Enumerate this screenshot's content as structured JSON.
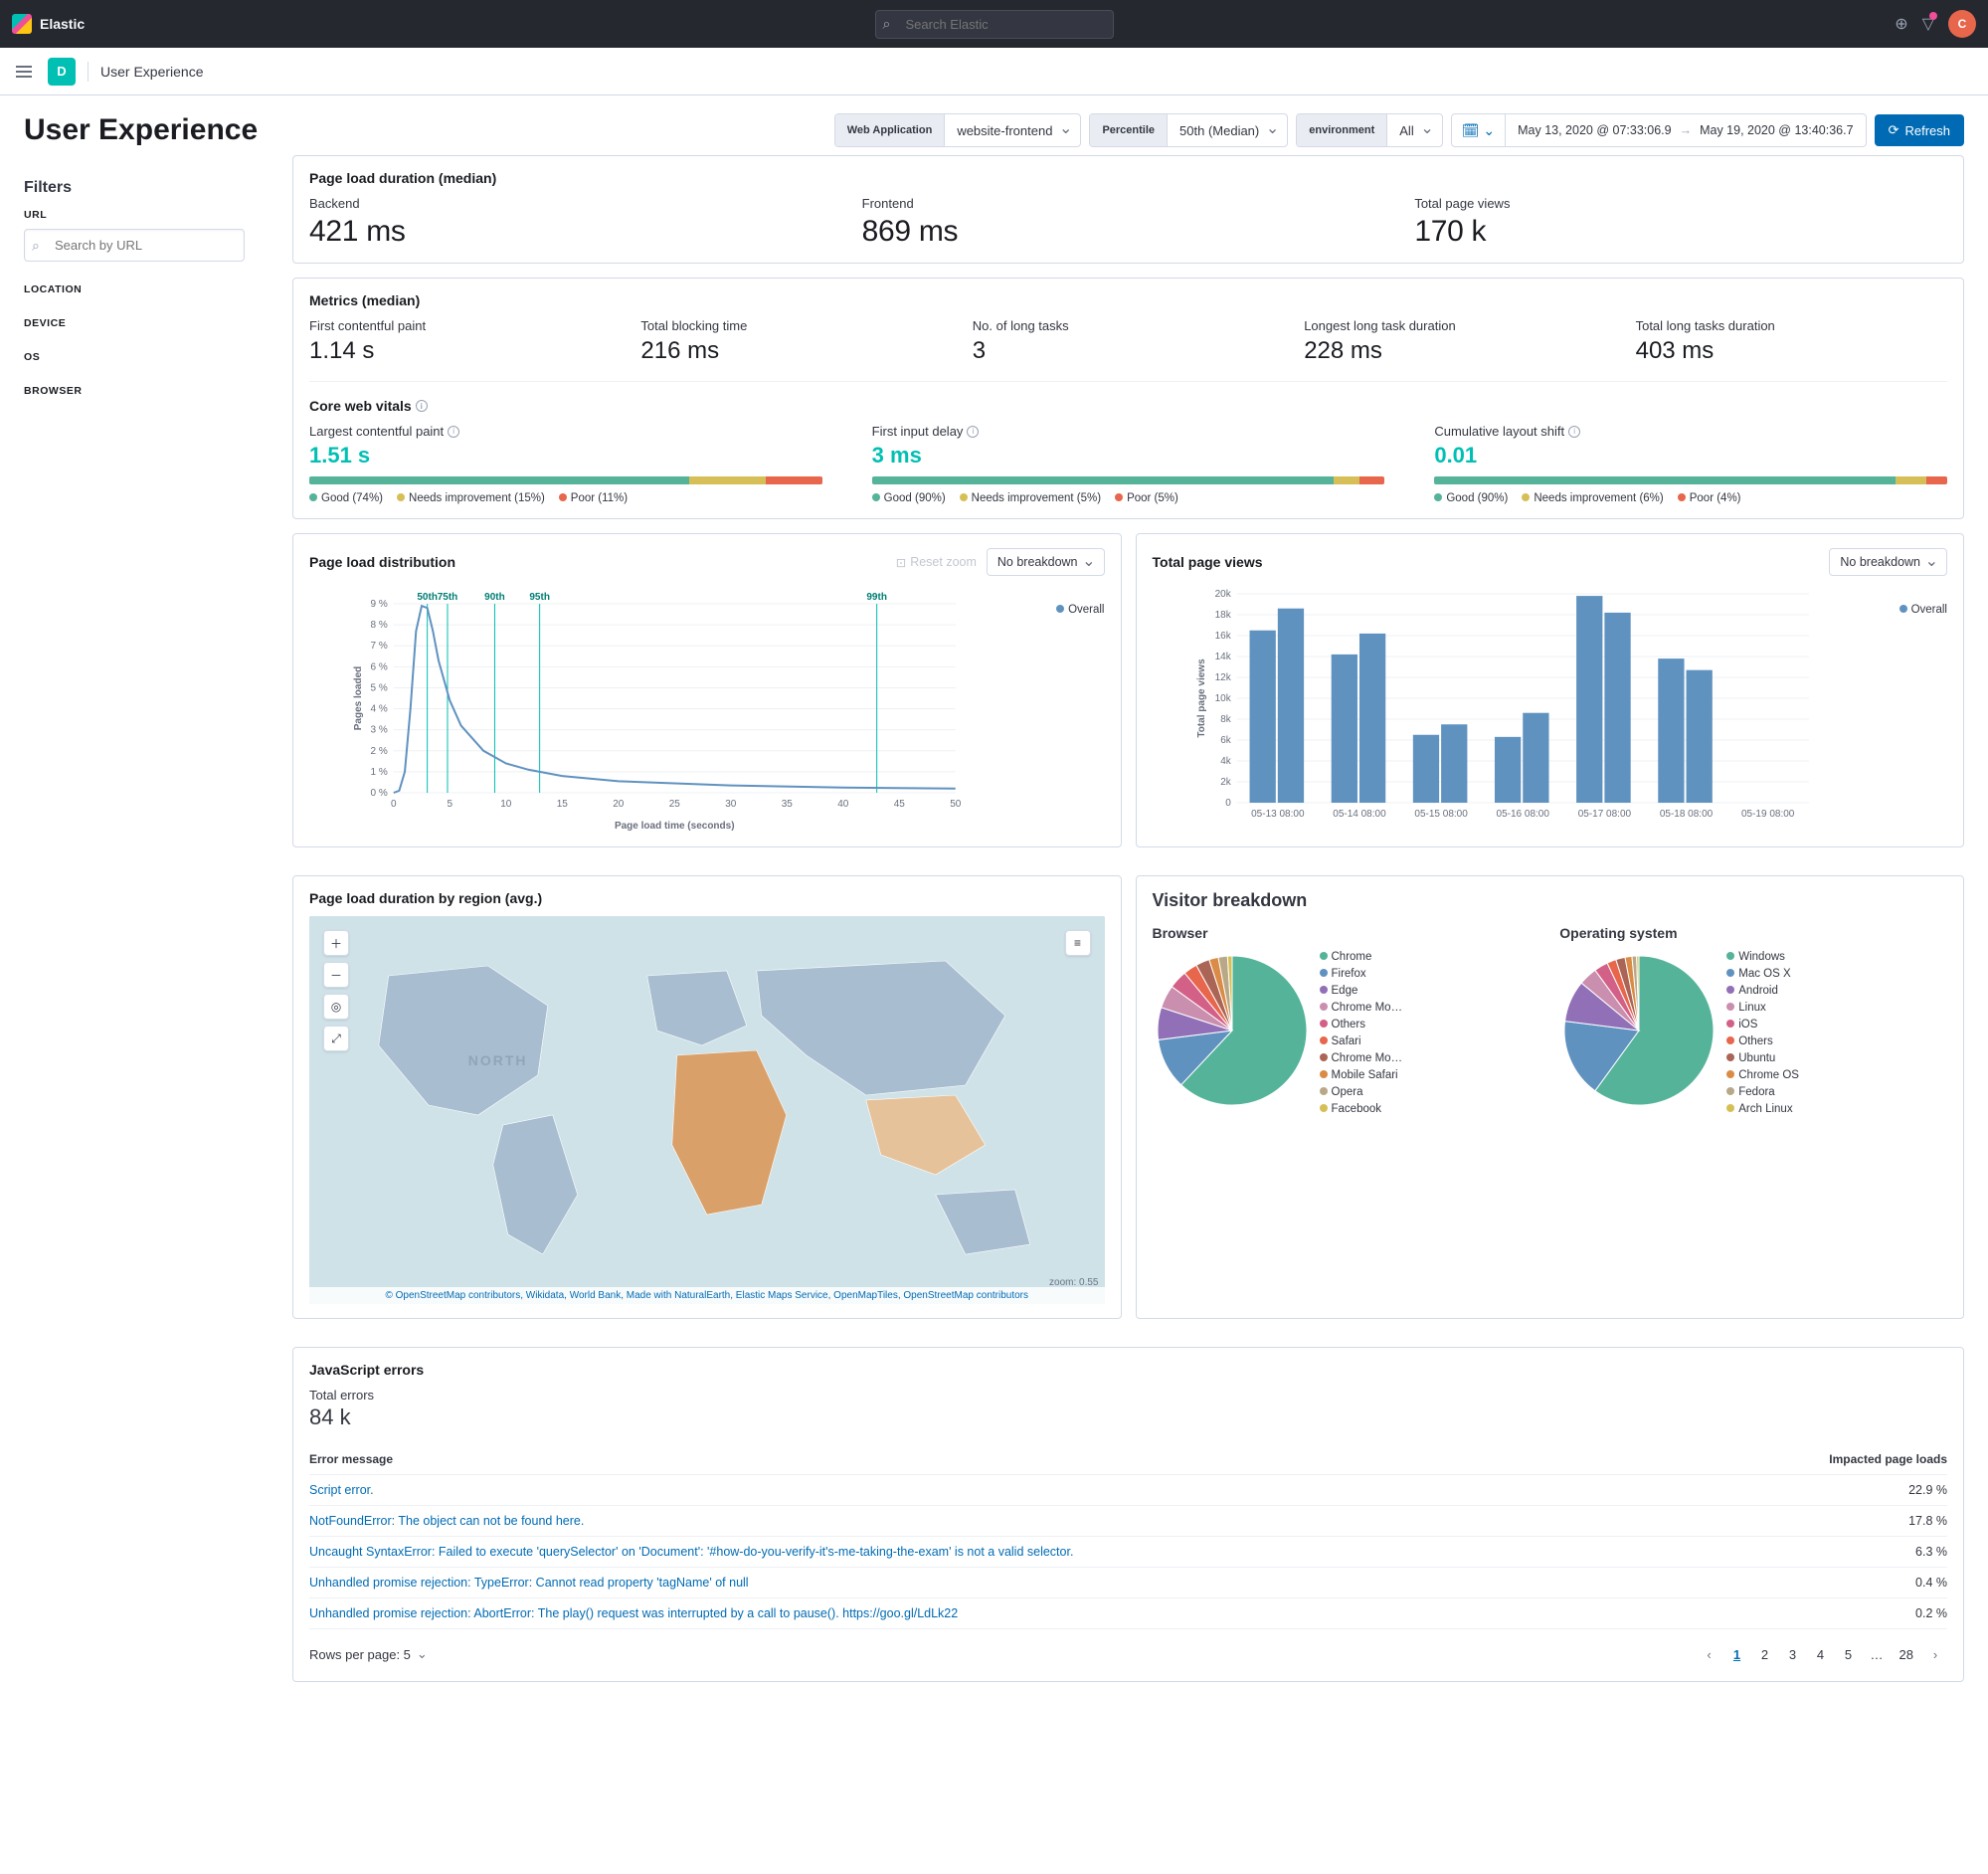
{
  "topbar": {
    "brand": "Elastic",
    "search_placeholder": "Search Elastic",
    "avatar_initial": "C"
  },
  "subbar": {
    "app_initial": "D",
    "breadcrumb": "User Experience"
  },
  "page": {
    "title": "User Experience",
    "web_app_label": "Web Application",
    "web_app_value": "website-frontend",
    "percentile_label": "Percentile",
    "percentile_value": "50th (Median)",
    "environment_label": "environment",
    "environment_value": "All",
    "date_from": "May 13, 2020 @ 07:33:06.9",
    "date_to": "May 19, 2020 @ 13:40:36.7",
    "refresh": "Refresh"
  },
  "filters": {
    "title": "Filters",
    "url_label": "URL",
    "url_placeholder": "Search by URL",
    "location_label": "LOCATION",
    "device_label": "DEVICE",
    "os_label": "OS",
    "browser_label": "BROWSER"
  },
  "page_load": {
    "title": "Page load duration (median)",
    "backend_label": "Backend",
    "backend_value": "421 ms",
    "frontend_label": "Frontend",
    "frontend_value": "869 ms",
    "views_label": "Total page views",
    "views_value": "170 k"
  },
  "metrics": {
    "title": "Metrics (median)",
    "fcp_label": "First contentful paint",
    "fcp_value": "1.14 s",
    "tbt_label": "Total blocking time",
    "tbt_value": "216 ms",
    "long_count_label": "No. of long tasks",
    "long_count_value": "3",
    "longest_label": "Longest long task duration",
    "longest_value": "228 ms",
    "total_long_label": "Total long tasks duration",
    "total_long_value": "403 ms"
  },
  "vitals": {
    "title": "Core web vitals",
    "lcp": {
      "label": "Largest contentful paint",
      "value": "1.51 s",
      "good": 74,
      "imp": 15,
      "poor": 11,
      "good_text": "Good (74%)",
      "imp_text": "Needs improvement (15%)",
      "poor_text": "Poor (11%)"
    },
    "fid": {
      "label": "First input delay",
      "value": "3 ms",
      "good": 90,
      "imp": 5,
      "poor": 5,
      "good_text": "Good (90%)",
      "imp_text": "Needs improvement (5%)",
      "poor_text": "Poor (5%)"
    },
    "cls": {
      "label": "Cumulative layout shift",
      "value": "0.01",
      "good": 90,
      "imp": 6,
      "poor": 4,
      "good_text": "Good (90%)",
      "imp_text": "Needs improvement (6%)",
      "poor_text": "Poor (4%)"
    }
  },
  "dist": {
    "title": "Page load distribution",
    "reset": "Reset zoom",
    "breakdown": "No breakdown",
    "legend": "Overall",
    "xlabel": "Page load time (seconds)",
    "ylabel": "Pages loaded",
    "p50": "50th",
    "p75": "75th",
    "p90": "90th",
    "p95": "95th",
    "p99": "99th"
  },
  "views": {
    "title": "Total page views",
    "breakdown": "No breakdown",
    "legend": "Overall",
    "ylabel": "Total page views"
  },
  "region": {
    "title": "Page load duration by region (avg.)",
    "attrib": "© OpenStreetMap contributors, Wikidata, World Bank, Made with NaturalEarth, Elastic Maps Service, OpenMapTiles, OpenStreetMap contributors",
    "zoom": "zoom: 0.55"
  },
  "visitor": {
    "title": "Visitor breakdown",
    "browser_title": "Browser",
    "os_title": "Operating system",
    "browsers": [
      "Chrome",
      "Firefox",
      "Edge",
      "Chrome Mo…",
      "Others",
      "Safari",
      "Chrome Mo…",
      "Mobile Safari",
      "Opera",
      "Facebook"
    ],
    "os": [
      "Windows",
      "Mac OS X",
      "Android",
      "Linux",
      "iOS",
      "Others",
      "Ubuntu",
      "Chrome OS",
      "Fedora",
      "Arch Linux"
    ]
  },
  "errors": {
    "title": "JavaScript errors",
    "total_label": "Total errors",
    "total_value": "84 k",
    "col_msg": "Error message",
    "col_pct": "Impacted page loads",
    "rows": [
      {
        "msg": "Script error.",
        "pct": "22.9 %"
      },
      {
        "msg": "NotFoundError: The object can not be found here.",
        "pct": "17.8 %"
      },
      {
        "msg": "Uncaught SyntaxError: Failed to execute 'querySelector' on 'Document': '#how-do-you-verify-it's-me-taking-the-exam' is not a valid selector.",
        "pct": "6.3 %"
      },
      {
        "msg": "Unhandled promise rejection: TypeError: Cannot read property 'tagName' of null",
        "pct": "0.4 %"
      },
      {
        "msg": "Unhandled promise rejection: AbortError: The play() request was interrupted by a call to pause(). https://goo.gl/LdLk22",
        "pct": "0.2 %"
      }
    ],
    "rows_per": "Rows per page: 5",
    "pages": [
      "1",
      "2",
      "3",
      "4",
      "5",
      "…",
      "28"
    ]
  },
  "palette": [
    "#54b399",
    "#6092c0",
    "#9170b8",
    "#ca8eae",
    "#d36086",
    "#e7664c",
    "#aa6556",
    "#da8b45",
    "#b9a888",
    "#d6bf57"
  ],
  "chart_data": [
    {
      "type": "line",
      "id": "page_load_distribution",
      "title": "Page load distribution",
      "xlabel": "Page load time (seconds)",
      "ylabel": "Pages loaded",
      "xlim": [
        0,
        50
      ],
      "ylim": [
        0,
        9
      ],
      "x_ticks": [
        0,
        5,
        10,
        15,
        20,
        25,
        30,
        35,
        40,
        45,
        50
      ],
      "y_ticks": [
        0,
        1,
        2,
        3,
        4,
        5,
        6,
        7,
        8,
        9
      ],
      "percentile_markers": {
        "50th": 3.0,
        "75th": 4.8,
        "90th": 9.0,
        "95th": 13.0,
        "99th": 43.0
      },
      "series": [
        {
          "name": "Overall",
          "x": [
            0,
            0.5,
            1,
            1.5,
            2,
            2.5,
            3,
            3.5,
            4,
            5,
            6,
            8,
            10,
            12,
            15,
            20,
            30,
            40,
            50
          ],
          "y": [
            0,
            0.1,
            1.0,
            4.0,
            7.7,
            8.9,
            8.8,
            7.7,
            6.3,
            4.4,
            3.2,
            2.0,
            1.4,
            1.1,
            0.8,
            0.55,
            0.35,
            0.25,
            0.2
          ]
        }
      ]
    },
    {
      "type": "bar",
      "id": "total_page_views",
      "title": "Total page views",
      "ylabel": "Total page views",
      "ylim": [
        0,
        20000
      ],
      "y_ticks": [
        0,
        2000,
        4000,
        6000,
        8000,
        10000,
        12000,
        14000,
        16000,
        18000,
        20000
      ],
      "categories": [
        "05-13 08:00",
        "05-14 08:00",
        "05-15 08:00",
        "05-16 08:00",
        "05-17 08:00",
        "05-18 08:00",
        "05-19 08:00"
      ],
      "series_per_category": 2,
      "values": [
        [
          16500,
          18600
        ],
        [
          14200,
          16200
        ],
        [
          6500,
          7500
        ],
        [
          6300,
          8600
        ],
        [
          19800,
          18200
        ],
        [
          13800,
          12700
        ],
        [
          0,
          0
        ]
      ]
    },
    {
      "type": "pie",
      "id": "browser_breakdown",
      "title": "Browser",
      "slices": [
        {
          "name": "Chrome",
          "value": 62,
          "color": "#54b399"
        },
        {
          "name": "Firefox",
          "value": 11,
          "color": "#6092c0"
        },
        {
          "name": "Edge",
          "value": 7,
          "color": "#9170b8"
        },
        {
          "name": "Chrome Mo…",
          "value": 5,
          "color": "#ca8eae"
        },
        {
          "name": "Others",
          "value": 4,
          "color": "#d36086"
        },
        {
          "name": "Safari",
          "value": 3,
          "color": "#e7664c"
        },
        {
          "name": "Chrome Mo…",
          "value": 3,
          "color": "#aa6556"
        },
        {
          "name": "Mobile Safari",
          "value": 2,
          "color": "#da8b45"
        },
        {
          "name": "Opera",
          "value": 2,
          "color": "#b9a888"
        },
        {
          "name": "Facebook",
          "value": 1,
          "color": "#d6bf57"
        }
      ]
    },
    {
      "type": "pie",
      "id": "os_breakdown",
      "title": "Operating system",
      "slices": [
        {
          "name": "Windows",
          "value": 60,
          "color": "#54b399"
        },
        {
          "name": "Mac OS X",
          "value": 17,
          "color": "#6092c0"
        },
        {
          "name": "Android",
          "value": 9,
          "color": "#9170b8"
        },
        {
          "name": "Linux",
          "value": 4,
          "color": "#ca8eae"
        },
        {
          "name": "iOS",
          "value": 3,
          "color": "#d36086"
        },
        {
          "name": "Others",
          "value": 2,
          "color": "#e7664c"
        },
        {
          "name": "Ubuntu",
          "value": 2,
          "color": "#aa6556"
        },
        {
          "name": "Chrome OS",
          "value": 1.5,
          "color": "#da8b45"
        },
        {
          "name": "Fedora",
          "value": 1,
          "color": "#b9a888"
        },
        {
          "name": "Arch Linux",
          "value": 0.5,
          "color": "#d6bf57"
        }
      ]
    }
  ]
}
